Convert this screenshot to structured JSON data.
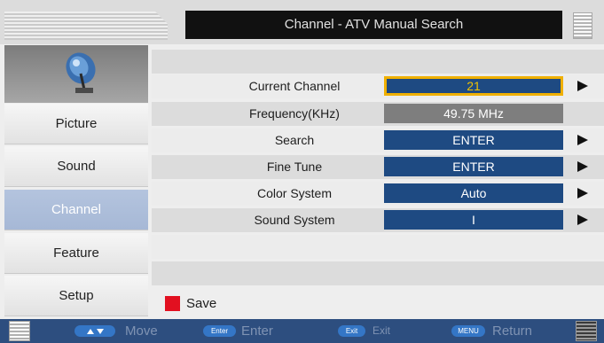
{
  "header": {
    "title": "Channel - ATV Manual Search"
  },
  "sidebar": {
    "items": [
      {
        "label": "Picture",
        "active": false
      },
      {
        "label": "Sound",
        "active": false
      },
      {
        "label": "Channel",
        "active": true
      },
      {
        "label": "Feature",
        "active": false
      },
      {
        "label": "Setup",
        "active": false
      }
    ]
  },
  "settings": [
    {
      "label": "Current Channel",
      "value": "21",
      "selected": true,
      "has_arrow": true
    },
    {
      "label": "Frequency(KHz)",
      "value": "49.75 MHz",
      "selected": false,
      "has_arrow": false
    },
    {
      "label": "Search",
      "value": "ENTER",
      "selected": false,
      "has_arrow": true
    },
    {
      "label": "Fine Tune",
      "value": "ENTER",
      "selected": false,
      "has_arrow": true
    },
    {
      "label": "Color System",
      "value": "Auto",
      "selected": false,
      "has_arrow": true
    },
    {
      "label": "Sound System",
      "value": "I",
      "selected": false,
      "has_arrow": true
    }
  ],
  "save": {
    "label": "Save",
    "color": "#e21020"
  },
  "footer": {
    "move": {
      "key": "▲▼",
      "label": "Move"
    },
    "enter": {
      "key": "Enter",
      "label": "Enter"
    },
    "exit": {
      "key": "Exit",
      "label": "Exit"
    },
    "return": {
      "key": "MENU",
      "label": "Return"
    }
  },
  "colors": {
    "value_box": "#1e4a82",
    "selected_border": "#f0b000",
    "sidebar_active": "#a6b8d6",
    "footer_bar": "#2d4e7f"
  }
}
